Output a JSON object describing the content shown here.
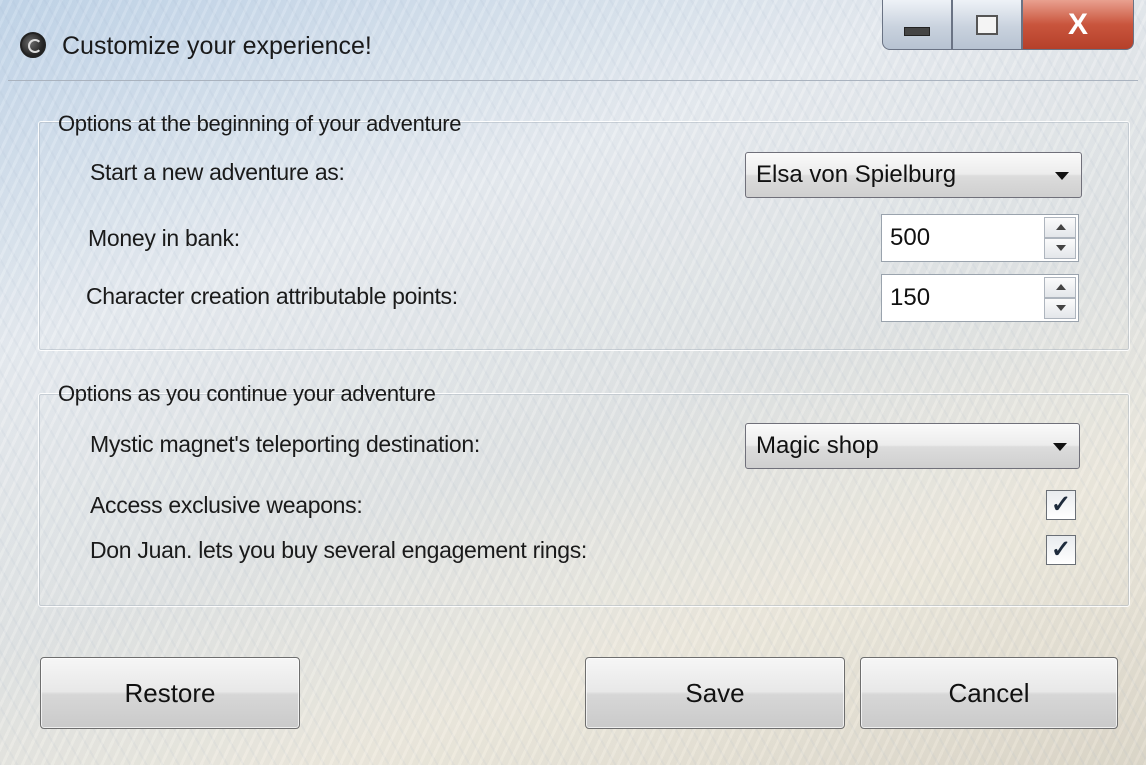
{
  "window": {
    "title": "Customize your experience!",
    "icon": "app-icon",
    "caption_buttons": {
      "minimize": "minimize-icon",
      "maximize": "maximize-icon",
      "close_label": "X"
    }
  },
  "group_start": {
    "title": "Options at the beginning of your adventure",
    "character_label": "Start a new adventure as:",
    "character_value": "Elsa von Spielburg",
    "money_label": "Money in bank:",
    "money_value": "500",
    "points_label": "Character creation attributable points:",
    "points_value": "150"
  },
  "group_continue": {
    "title": "Options as you continue your adventure",
    "teleport_label": "Mystic magnet's teleporting destination:",
    "teleport_value": "Magic shop",
    "weapons_label": "Access exclusive weapons:",
    "weapons_checked": true,
    "rings_label": "Don Juan. lets you buy several engagement rings:",
    "rings_checked": true
  },
  "buttons": {
    "restore": "Restore",
    "save": "Save",
    "cancel": "Cancel"
  },
  "glyphs": {
    "check": "✓"
  }
}
